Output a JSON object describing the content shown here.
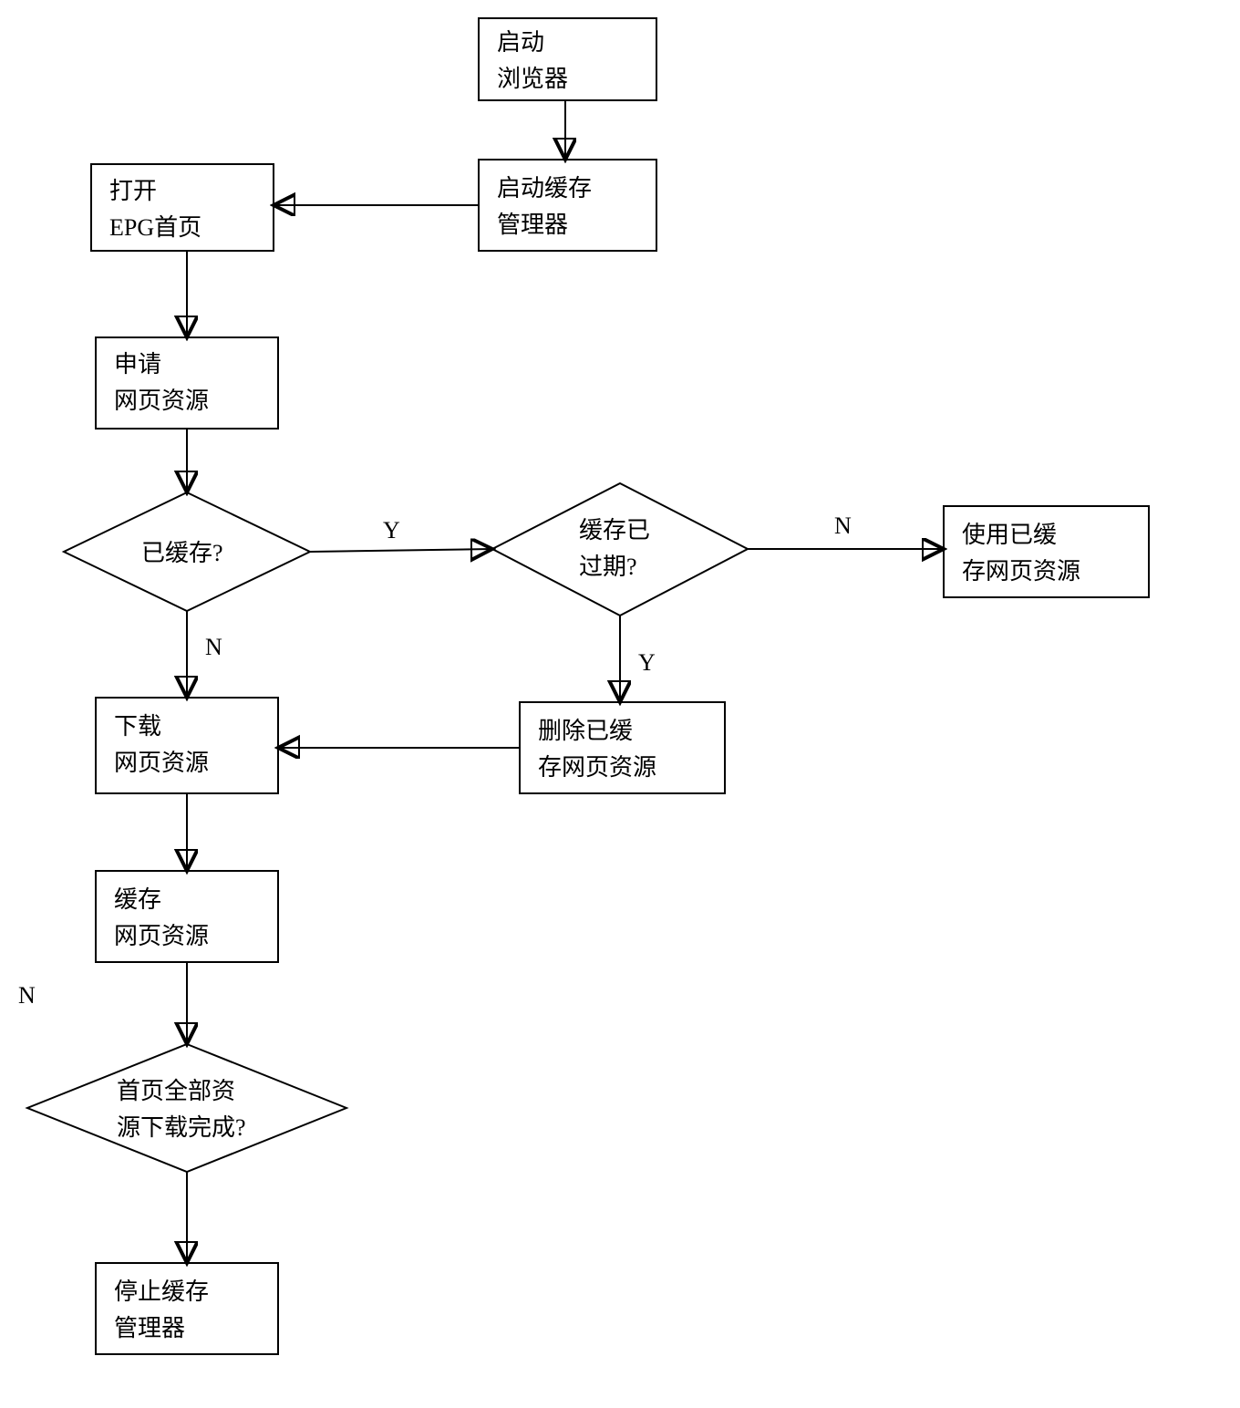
{
  "nodes": {
    "start": {
      "l1": "启动",
      "l2": "浏览器"
    },
    "cacheMgr": {
      "l1": "启动缓存",
      "l2": "管理器"
    },
    "openEpg": {
      "l1": "打开",
      "l2": "EPG首页"
    },
    "reqRes": {
      "l1": "申请",
      "l2": "网页资源"
    },
    "cachedQ": {
      "l1": "已缓存?"
    },
    "expiredQ": {
      "l1": "缓存已",
      "l2": "过期?"
    },
    "useCached": {
      "l1": "使用已缓",
      "l2": "存网页资源"
    },
    "download": {
      "l1": "下载",
      "l2": "网页资源"
    },
    "delCached": {
      "l1": "删除已缓",
      "l2": "存网页资源"
    },
    "storeCache": {
      "l1": "缓存",
      "l2": "网页资源"
    },
    "allDoneQ": {
      "l1": "首页全部资",
      "l2": "源下载完成?"
    },
    "stopMgr": {
      "l1": "停止缓存",
      "l2": "管理器"
    }
  },
  "labels": {
    "Y": "Y",
    "N": "N"
  }
}
